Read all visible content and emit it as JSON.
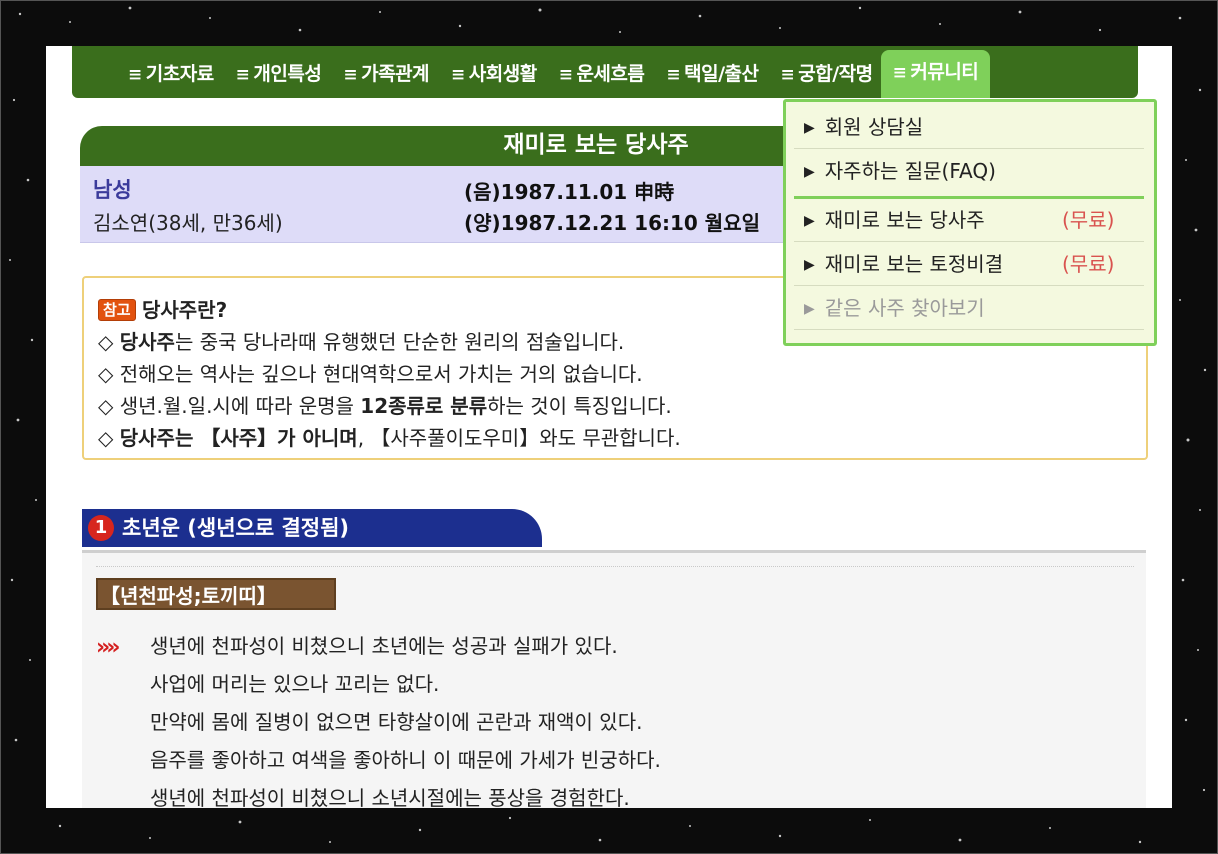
{
  "nav": {
    "items": [
      {
        "label": "기초자료"
      },
      {
        "label": "개인특성"
      },
      {
        "label": "가족관계"
      },
      {
        "label": "사회생활"
      },
      {
        "label": "운세흐름"
      },
      {
        "label": "택일/출산"
      },
      {
        "label": "궁합/작명"
      },
      {
        "label": "커뮤니티",
        "active": true
      }
    ],
    "marker": "≡"
  },
  "header": {
    "title": "재미로 보는 당사주"
  },
  "profile": {
    "gender": "남성",
    "name_age": "김소연(38세, 만36세)",
    "lunar": "(음)1987.11.01 申時",
    "solar": "(양)1987.12.21 16:10 월요일"
  },
  "note": {
    "badge": "참고",
    "title": "당사주란?",
    "diamond": "◇",
    "line1_bold": "당사주",
    "line1_rest": "는 중국 당나라때 유행했던 단순한 원리의 점술입니다.",
    "line2": "전해오는 역사는 깊으나 현대역학으로서 가치는 거의 없습니다.",
    "line3_a": "생년.월.일.시에 따라 운명을 ",
    "line3_bold": "12종류로 분류",
    "line3_b": "하는 것이 특징입니다.",
    "line4_bold": "당사주는 【사주】가 아니며",
    "line4_rest": ", 【사주풀이도우미】와도 무관합니다."
  },
  "section": {
    "number": "1",
    "title": "초년운 (생년으로 결정됨)",
    "star_label": "【년천파성;토끼띠】",
    "bullet": "»",
    "lines": [
      "생년에 천파성이 비쳤으니 초년에는 성공과 실패가 있다.",
      "사업에 머리는 있으나 꼬리는 없다.",
      "만약에 몸에 질병이 없으면 타향살이에 곤란과 재액이 있다.",
      "음주를 좋아하고 여색을 좋아하니 이 때문에 가세가 빈궁하다.",
      "생년에 천파성이 비쳤으니 소년시절에는 풍상을 경험한다."
    ]
  },
  "dropdown": {
    "items": [
      {
        "label": "회원 상담실",
        "free": ""
      },
      {
        "label": "자주하는 질문(FAQ)",
        "free": ""
      },
      {
        "label": "재미로 보는 당사주",
        "free": "(무료)"
      },
      {
        "label": "재미로 보는 토정비결",
        "free": "(무료)"
      },
      {
        "label": "같은 사주 찾아보기",
        "free": "",
        "disabled": true
      }
    ],
    "triangle": "▶"
  },
  "colors": {
    "nav_green": "#3a6e1c",
    "active_green": "#7fd05a",
    "profile_bg": "#dedcf8",
    "section_blue": "#1c2f8f",
    "badge_orange": "#e2520f",
    "free_red": "#d9534f"
  }
}
